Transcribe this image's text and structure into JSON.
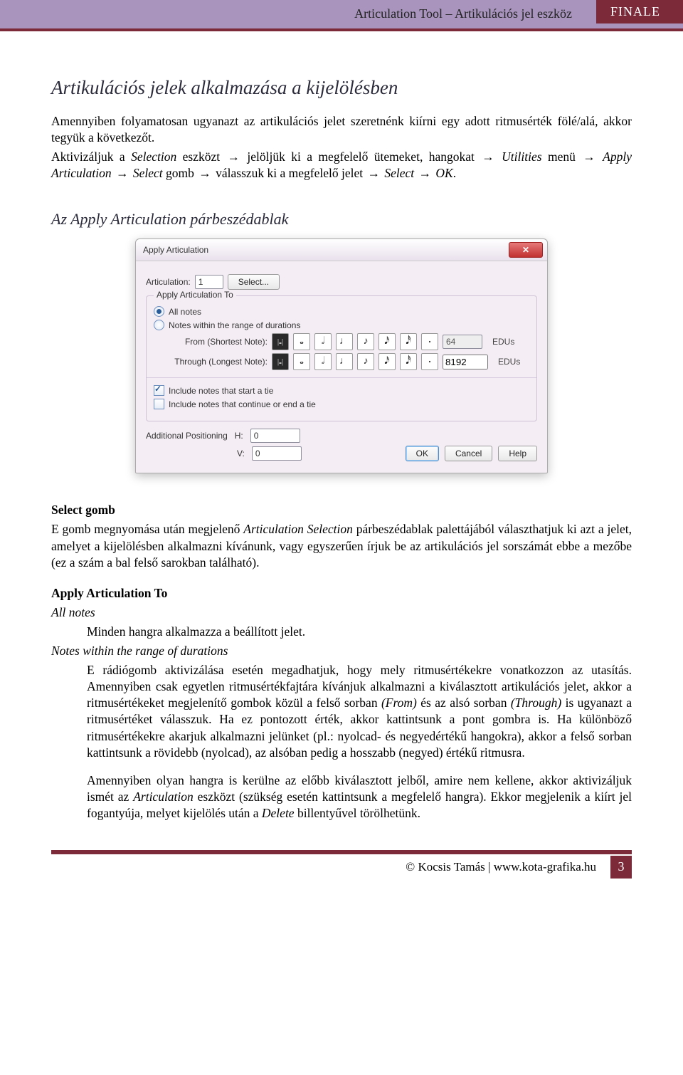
{
  "header": {
    "title": "Articulation Tool – Artikulációs jel eszköz",
    "badge": "FINALE"
  },
  "section1": {
    "title": "Artikulációs jelek alkalmazása a kijelölésben",
    "p1": "Amennyiben folyamatosan ugyanazt az artikulációs jelet szeretnénk kiírni egy adott ritmusérték fölé/alá, akkor tegyük a következőt.",
    "p2_pre": "Aktivizáljuk a ",
    "p2_it1": "Selection",
    "p2_mid1": " eszközt ",
    "p2_arr": "→",
    "p2_mid2": " jelöljük ki a megfelelő ütemeket, hangokat ",
    "p2_it2": "Utilities",
    "p2_mid3": " menü ",
    "p2_it3": "Apply Articulation",
    "p2_mid4": " ",
    "p2_it4": "Select",
    "p2_mid5": " gomb ",
    "p2_mid6": " válasszuk ki a megfelelő jelet ",
    "p2_it5": "Select",
    "p2_it6": "OK",
    "p2_end": "."
  },
  "section2": {
    "title": "Az Apply Articulation párbeszédablak"
  },
  "dialog": {
    "title": "Apply Articulation",
    "close_glyph": "✕",
    "articulation_label": "Articulation:",
    "articulation_value": "1",
    "select_btn": "Select...",
    "group_legend": "Apply Articulation To",
    "opt_all": "All notes",
    "opt_range": "Notes within the range of durations",
    "from_label": "From (Shortest Note):",
    "through_label": "Through (Longest Note):",
    "from_value": "64",
    "through_value": "8192",
    "edus": "EDUs",
    "note_whole": "𝅝",
    "note_half": "𝅗𝅥",
    "note_quarter": "♩",
    "note_eighth": "♪",
    "note_sixteenth": "𝅘𝅥𝅯",
    "note_thirtysecond": "𝅘𝅥𝅰",
    "note_dot": "·",
    "chk_start_tie": "Include notes that start a tie",
    "chk_end_tie": "Include notes that continue or end a tie",
    "pos_label": "Additional Positioning",
    "pos_h_label": "H:",
    "pos_h_value": "0",
    "pos_v_label": "V:",
    "pos_v_value": "0",
    "ok": "OK",
    "cancel": "Cancel",
    "help": "Help"
  },
  "lower": {
    "select_h": "Select gomb",
    "select_p_a": "E gomb megnyomása után megjelenő ",
    "select_p_it": "Articulation Selection",
    "select_p_b": " párbeszédablak palettájából választ­hatjuk ki azt a jelet, amelyet a kijelölésben alkalmazni kívánunk, vagy egyszerűen írjuk be az artikulációs jel sorszámát ebbe a mezőbe (ez a szám a bal felső sarokban található).",
    "apply_h": "Apply Articulation To",
    "all_it": "All notes",
    "all_desc": "Minden hangra alkalmazza a beállított jelet.",
    "range_it": "Notes within the range of durations",
    "range_p1_a": "E rádiógomb aktivizálása esetén megadhatjuk, hogy mely ritmusértékekre vonatkozzon az utasítás. Amennyiben csak egyetlen ritmusértékfajtára kívánjuk alkalmazni a kiválasztott artikulációs jelet, akkor a ritmusértékeket megjelenítő gombok közül a felső sorban ",
    "range_p1_it1": "(From)",
    "range_p1_b": " és az alsó sorban ",
    "range_p1_it2": "(Through)",
    "range_p1_c": " is ugyanazt a ritmusértéket válasszuk. Ha ez pontozott érték, akkor kattintsunk a pont gombra is. Ha különböző ritmusértékekre akarjuk alkalmazni jelünket (pl.: nyolcad- és negyedértékű hangokra), akkor a felső sorban kattintsunk a rövidebb (nyolcad), az alsóban pedig a hosszabb (negyed) értékű ritmusra.",
    "range_p2_a": "Amennyiben olyan hangra is kerülne az előbb kiválasztott jelből, amire nem kellene, akkor aktivizáljuk ismét az ",
    "range_p2_it1": "Articulation",
    "range_p2_b": " eszközt (szükség esetén kattintsunk a megfelelő hangra). Ekkor megjelenik a kiírt jel fogantyúja, melyet kijelölés után a ",
    "range_p2_it2": "Delete",
    "range_p2_c": " billentyűvel törölhetünk."
  },
  "footer": {
    "text": "© Kocsis Tamás | www.kota-grafika.hu",
    "page": "3"
  }
}
